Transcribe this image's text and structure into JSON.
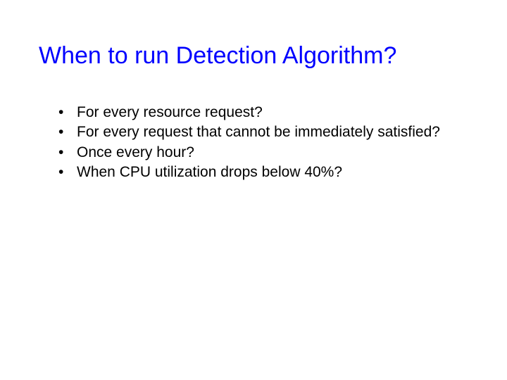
{
  "slide": {
    "title": "When to run Detection Algorithm?",
    "bullets": [
      "For every resource request?",
      "For every request that cannot be immediately satisfied?",
      "Once every hour?",
      "When CPU utilization drops below  40%?"
    ]
  }
}
